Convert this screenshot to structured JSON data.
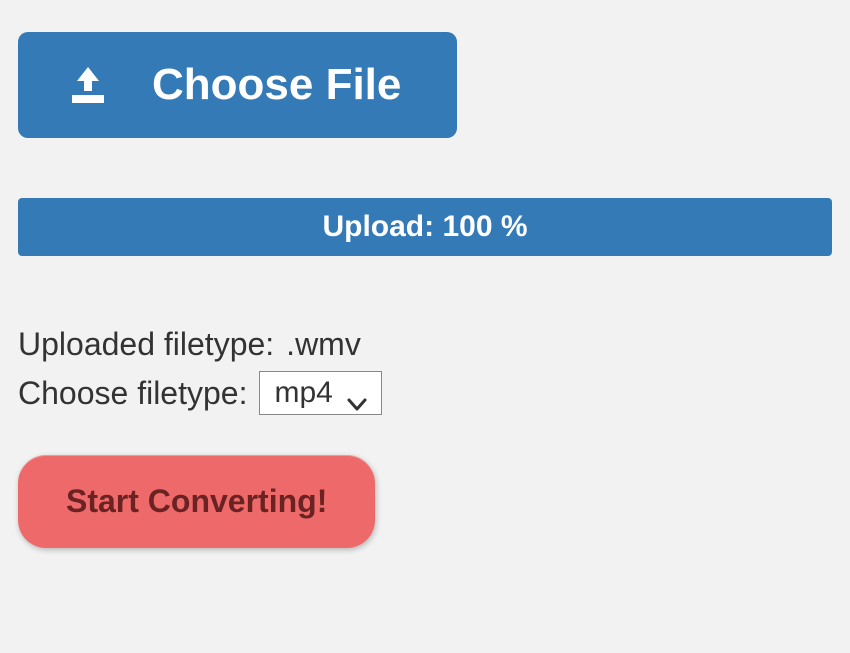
{
  "choose_file_label": "Choose File",
  "upload_status_text": "Upload: 100 %",
  "uploaded_filetype_label": "Uploaded filetype:",
  "uploaded_filetype_value": ".wmv",
  "choose_filetype_label": "Choose filetype:",
  "selected_filetype": "mp4",
  "start_button_label": "Start Converting!",
  "colors": {
    "primary": "#337ab7",
    "danger": "#ee6a6a"
  }
}
